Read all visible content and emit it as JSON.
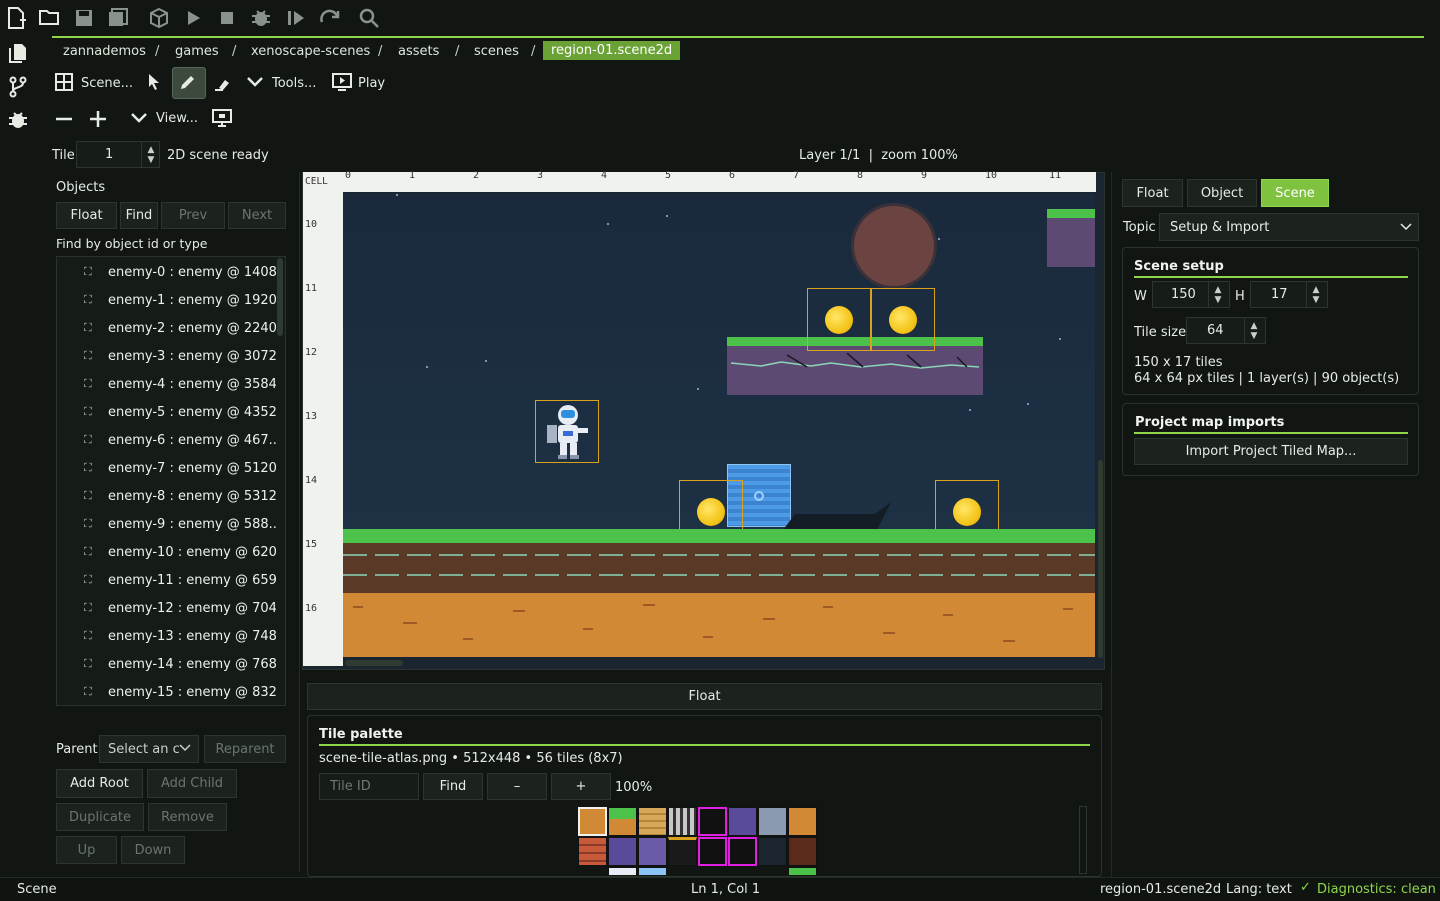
{
  "toolbar": {
    "icons": [
      "new-file-icon",
      "open-folder-icon",
      "save-icon",
      "save-all-icon",
      "build-icon",
      "run-icon",
      "stop-icon",
      "debug-icon",
      "step-icon",
      "restart-icon",
      "search-icon"
    ]
  },
  "activity_bar": [
    "explorer-icon",
    "source-control-icon",
    "debug-icon"
  ],
  "breadcrumbs": [
    "zannademos",
    "games",
    "xenoscape-scenes",
    "assets",
    "scenes",
    "region-01.scene2d"
  ],
  "scene_toolbar": {
    "scene_label": "Scene...",
    "tools_label": "Tools...",
    "play_label": "Play",
    "view_label": "View..."
  },
  "tile_row": {
    "label": "Tile",
    "value": "1",
    "status": "2D scene ready"
  },
  "viewport_status": "Layer 1/1  |  zoom 100%",
  "objects": {
    "title": "Objects",
    "float_label": "Float",
    "find_label": "Find",
    "prev_label": "Prev",
    "next_label": "Next",
    "find_hint": "Find by object id or type",
    "items": [
      "enemy-0  :  enemy  @ 1408...",
      "enemy-1  :  enemy  @ 1920,...",
      "enemy-2  :  enemy  @ 2240...",
      "enemy-3  :  enemy  @ 3072...",
      "enemy-4  :  enemy  @ 3584...",
      "enemy-5  :  enemy  @ 4352...",
      "enemy-6  :  enemy  @ 467...",
      "enemy-7  :  enemy  @ 5120...",
      "enemy-8  :  enemy  @ 5312...",
      "enemy-9  :  enemy  @ 588...",
      "enemy-10  :  enemy  @ 620...",
      "enemy-11  :  enemy  @ 659...",
      "enemy-12  :  enemy  @ 704...",
      "enemy-13  :  enemy  @ 748...",
      "enemy-14  :  enemy  @ 768...",
      "enemy-15  :  enemy  @ 832..."
    ],
    "parent_label": "Parent",
    "parent_placeholder": "Select an c",
    "reparent_label": "Reparent",
    "add_root_label": "Add Root",
    "add_child_label": "Add Child",
    "duplicate_label": "Duplicate",
    "remove_label": "Remove",
    "up_label": "Up",
    "down_label": "Down"
  },
  "ruler": {
    "corner": "CELL",
    "columns": [
      "0",
      "1",
      "2",
      "3",
      "4",
      "5",
      "6",
      "7",
      "8",
      "9",
      "10",
      "11"
    ],
    "rows": [
      "10",
      "11",
      "12",
      "13",
      "14",
      "15",
      "16"
    ]
  },
  "float_bar_label": "Float",
  "tile_palette": {
    "title": "Tile palette",
    "info": "scene-tile-atlas.png • 512x448 • 56 tiles (8x7)",
    "tile_id_placeholder": "Tile ID",
    "find_label": "Find",
    "minus_label": "–",
    "plus_label": "+",
    "zoom": "100%"
  },
  "inspector": {
    "tabs": [
      "Float",
      "Object",
      "Scene"
    ],
    "topic_label": "Topic",
    "topic_value": "Setup & Import",
    "scene_setup_title": "Scene setup",
    "w_label": "W",
    "w_value": "150",
    "h_label": "H",
    "h_value": "17",
    "tile_size_label": "Tile size",
    "tile_size_value": "64",
    "tiles_info": "150 x 17 tiles",
    "details_info": "64 x 64 px tiles | 1 layer(s) | 90 object(s)",
    "imports_title": "Project map imports",
    "import_button": "Import Project Tiled Map..."
  },
  "status_bar": {
    "left": "Scene",
    "position": "Ln 1, Col 1",
    "file": "region-01.scene2d",
    "lang": "Lang: text",
    "diagnostics": "Diagnostics: clean"
  },
  "colors": {
    "accent": "#8fd64a",
    "background": "#111612",
    "sky": "#1c2d3f",
    "selection": "#d9a21a"
  }
}
